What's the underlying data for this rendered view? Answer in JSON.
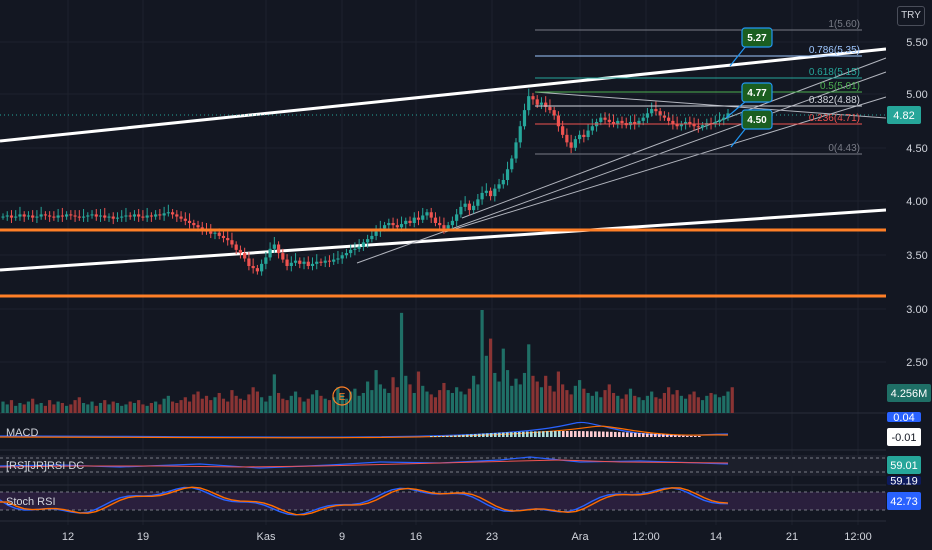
{
  "currency": "TRY",
  "chart_data": {
    "type": "candlestick",
    "price_axis": {
      "ticks": [
        "5.50",
        "5.00",
        "4.50",
        "4.00",
        "3.50",
        "3.00",
        "2.50"
      ],
      "ylim": [
        2.25,
        5.75
      ]
    },
    "time_axis": {
      "ticks": [
        "12",
        "19",
        "Kas",
        "9",
        "16",
        "23",
        "Ara",
        "12:00",
        "14",
        "21",
        "12:00"
      ]
    },
    "current_price": "4.82",
    "volume_label": "4.256M",
    "fibonacci": [
      {
        "label": "1(5.60)",
        "value": 5.6,
        "color": "#787b86"
      },
      {
        "label": "0.786(5.35)",
        "value": 5.35,
        "color": "#9ec7ff"
      },
      {
        "label": "0.618(5.15)",
        "value": 5.15,
        "color": "#26a69a"
      },
      {
        "label": "0.5(5.01)",
        "value": 5.01,
        "color": "#4caf50"
      },
      {
        "label": "0.382(4.88)",
        "value": 4.88,
        "color": "#d1d4dc"
      },
      {
        "label": "0.236(4.71)",
        "value": 4.71,
        "color": "#ef5350"
      },
      {
        "label": "0(4.43)",
        "value": 4.43,
        "color": "#787b86"
      }
    ],
    "horizontal_levels": [
      {
        "label": "3.73",
        "value": 3.73,
        "color": "#ff7f27"
      },
      {
        "label": "3.11",
        "value": 3.11,
        "color": "#ff7f27"
      }
    ],
    "callouts": [
      "5.27",
      "4.77",
      "4.50"
    ],
    "earnings_marker": "E",
    "series_close": [
      3.86,
      3.87,
      3.85,
      3.86,
      3.88,
      3.86,
      3.87,
      3.85,
      3.86,
      3.88,
      3.87,
      3.86,
      3.85,
      3.87,
      3.86,
      3.88,
      3.87,
      3.86,
      3.85,
      3.86,
      3.87,
      3.88,
      3.86,
      3.87,
      3.85,
      3.86,
      3.84,
      3.85,
      3.86,
      3.87,
      3.86,
      3.88,
      3.86,
      3.85,
      3.87,
      3.86,
      3.88,
      3.87,
      3.89,
      3.9,
      3.88,
      3.86,
      3.84,
      3.82,
      3.8,
      3.78,
      3.76,
      3.74,
      3.72,
      3.7,
      3.71,
      3.68,
      3.66,
      3.64,
      3.6,
      3.55,
      3.52,
      3.47,
      3.4,
      3.38,
      3.35,
      3.42,
      3.48,
      3.56,
      3.6,
      3.52,
      3.46,
      3.4,
      3.43,
      3.45,
      3.42,
      3.44,
      3.4,
      3.42,
      3.44,
      3.43,
      3.45,
      3.44,
      3.46,
      3.47,
      3.5,
      3.52,
      3.55,
      3.56,
      3.58,
      3.62,
      3.65,
      3.68,
      3.72,
      3.75,
      3.78,
      3.8,
      3.78,
      3.76,
      3.79,
      3.82,
      3.8,
      3.85,
      3.83,
      3.87,
      3.9,
      3.85,
      3.8,
      3.78,
      3.75,
      3.78,
      3.82,
      3.88,
      3.95,
      3.98,
      3.92,
      3.96,
      4.02,
      4.08,
      4.1,
      4.05,
      4.12,
      4.16,
      4.2,
      4.3,
      4.4,
      4.55,
      4.7,
      4.85,
      4.98,
      4.95,
      4.9,
      4.92,
      4.88,
      4.85,
      4.8,
      4.7,
      4.62,
      4.55,
      4.5,
      4.58,
      4.62,
      4.6,
      4.66,
      4.7,
      4.74,
      4.78,
      4.76,
      4.74,
      4.72,
      4.75,
      4.73,
      4.71,
      4.74,
      4.72,
      4.75,
      4.78,
      4.82,
      4.86,
      4.84,
      4.8,
      4.78,
      4.75,
      4.72,
      4.7,
      4.72,
      4.74,
      4.72,
      4.7,
      4.69,
      4.71,
      4.73,
      4.72,
      4.74,
      4.76,
      4.78,
      4.82
    ],
    "volume": [
      0.8,
      0.6,
      0.9,
      0.5,
      0.7,
      0.6,
      0.8,
      1.0,
      0.6,
      0.7,
      0.5,
      0.9,
      0.6,
      0.8,
      0.7,
      0.5,
      0.6,
      0.9,
      1.1,
      0.7,
      0.6,
      0.8,
      0.5,
      0.7,
      0.9,
      0.6,
      0.8,
      0.7,
      0.5,
      0.6,
      0.8,
      0.7,
      0.9,
      0.6,
      0.5,
      0.7,
      0.8,
      0.6,
      1.0,
      1.2,
      0.8,
      0.7,
      0.9,
      1.1,
      0.8,
      1.3,
      1.5,
      1.0,
      1.2,
      0.9,
      1.1,
      1.4,
      1.0,
      0.8,
      1.6,
      1.2,
      1.0,
      0.9,
      1.3,
      1.8,
      1.5,
      1.1,
      0.8,
      1.2,
      2.7,
      1.4,
      1.0,
      0.9,
      1.2,
      1.5,
      1.1,
      0.8,
      1.0,
      1.3,
      1.6,
      1.2,
      1.0,
      0.9,
      1.1,
      1.8,
      1.3,
      1.0,
      1.5,
      1.7,
      1.2,
      1.4,
      2.2,
      1.6,
      3.0,
      2.0,
      1.7,
      1.4,
      2.5,
      1.8,
      7.0,
      2.6,
      2.0,
      1.4,
      2.9,
      1.9,
      1.5,
      1.3,
      1.1,
      1.6,
      2.1,
      1.6,
      1.4,
      1.8,
      1.5,
      1.3,
      1.7,
      2.6,
      2.0,
      7.2,
      4.0,
      5.2,
      2.8,
      2.2,
      4.5,
      3.0,
      1.9,
      2.4,
      2.0,
      2.8,
      4.8,
      2.6,
      2.2,
      1.8,
      2.6,
      1.9,
      1.5,
      2.9,
      2.0,
      1.6,
      1.3,
      1.9,
      2.3,
      1.7,
      1.4,
      1.2,
      1.5,
      1.1,
      1.6,
      2.0,
      1.4,
      1.2,
      1.0,
      1.3,
      1.7,
      1.2,
      1.1,
      0.9,
      1.2,
      1.5,
      1.1,
      1.0,
      1.4,
      1.8,
      1.3,
      1.6,
      1.2,
      1.0,
      1.3,
      1.5,
      1.1,
      0.9,
      1.2,
      1.4,
      1.3,
      1.1,
      1.2,
      1.5,
      1.8
    ],
    "indicators": [
      {
        "name": "MACD",
        "value": "0.04",
        "value2": "-0.01"
      },
      {
        "name": "[RS][JR]RSI DC",
        "value": "59.01",
        "value2": "59.19"
      },
      {
        "name": "Stoch RSI",
        "value": "42.73"
      }
    ]
  }
}
